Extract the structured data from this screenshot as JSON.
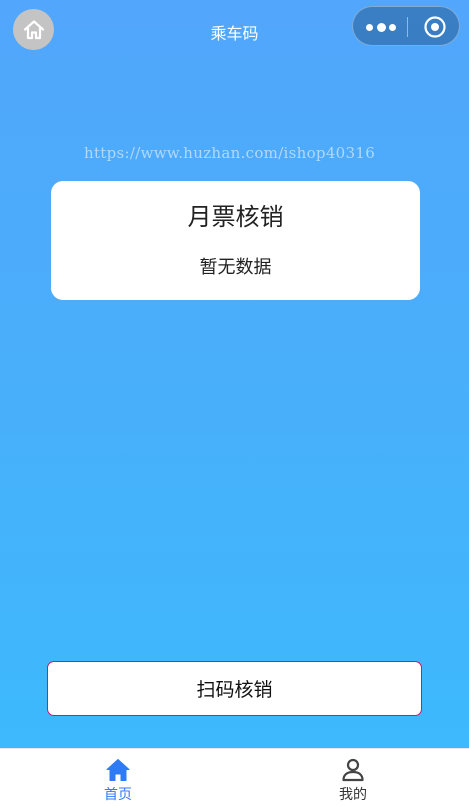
{
  "nav": {
    "title": "乘车码",
    "home_icon": "home-icon",
    "menu_icon": "more-dots-icon",
    "close_icon": "target-circle-icon"
  },
  "watermark": "https://www.huzhan.com/ishop40316",
  "card": {
    "title": "月票核销",
    "empty_text": "暂无数据"
  },
  "scan_button": {
    "label": "扫码核销"
  },
  "tabbar": {
    "items": [
      {
        "label": "首页",
        "icon": "home-icon",
        "active": true
      },
      {
        "label": "我的",
        "icon": "user-icon",
        "active": false
      }
    ]
  },
  "colors": {
    "background_top": "#52a6fb",
    "background_bottom": "#3db9fd",
    "active_tab": "#2f7bf5",
    "scan_button_border": "#b5236b"
  }
}
